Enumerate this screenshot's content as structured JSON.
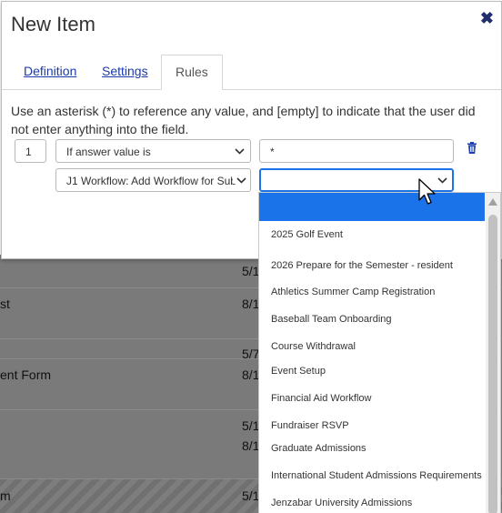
{
  "modal": {
    "title": "New Item",
    "close_icon": "close-icon",
    "tabs": [
      {
        "label": "Definition",
        "active": false
      },
      {
        "label": "Settings",
        "active": false
      },
      {
        "label": "Rules",
        "active": true
      }
    ],
    "description": "Use an asterisk (*) to reference any value, and [empty] to indicate that the user did not enter anything into the field.",
    "rule": {
      "number": "1",
      "condition": "If answer value is",
      "value": "*",
      "action": "J1 Workflow: Add Workflow for Sub",
      "target_value": ""
    }
  },
  "dropdown": {
    "selected_index": 0,
    "options": [
      "",
      "2025 Golf Event",
      "2026 Prepare for the Semester - resident",
      "Athletics Summer Camp Registration",
      "Baseball Team Onboarding",
      "Course Withdrawal",
      "Event Setup",
      "Financial Aid Workflow",
      "Fundraiser RSVP",
      "Graduate Admissions",
      "International Student Admissions Requirements",
      "Jenzabar University Admissions"
    ]
  },
  "background": {
    "rows": [
      {
        "left": "",
        "date": "5/1"
      },
      {
        "left": "st",
        "date": "8/1"
      },
      {
        "left": "",
        "date": "5/7"
      },
      {
        "left": "ent Form",
        "date": "8/1"
      },
      {
        "left": "",
        "date": "5/1"
      },
      {
        "left": "",
        "date": "8/1"
      },
      {
        "left": "m",
        "date": "5/1"
      }
    ]
  },
  "colors": {
    "accent": "#1a73e8",
    "link": "#1a3ba8",
    "close": "#1f2d6b",
    "trash": "#1f3fae"
  }
}
